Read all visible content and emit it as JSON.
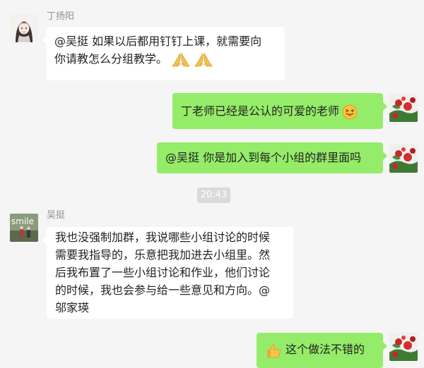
{
  "messages": [
    {
      "sender": "丁扬阳",
      "line1": "@吴挺 如果以后都用钉钉上课，就需要向",
      "line2": "你请教怎么分组教学。",
      "emoji": "folded-hands"
    },
    {
      "text": "丁老师已经是公认的可爱的老师",
      "emoji": "tongue-face"
    },
    {
      "text": "@吴挺 你是加入到每个小组的群里面吗"
    },
    {
      "sender": "吴挺",
      "avatar_text": "smile",
      "lines": [
        "我也没强制加群，我说哪些小组讨论的时候",
        "需要我指导的，乐意把我加进去小组里。然",
        "后我布置了一些小组讨论和作业，他们讨论",
        "的时候，我也会参与给一些意见和方向。@",
        "邬家瑛"
      ]
    },
    {
      "text": "这个做法不错的",
      "emoji": "thumbs-up"
    }
  ],
  "timestamp": "20:43",
  "colors": {
    "background": "#f5f5f5",
    "incoming_bubble": "#ffffff",
    "outgoing_bubble": "#95ec69",
    "sender_name": "#8f8f8f",
    "time_chip": "#dadada"
  }
}
